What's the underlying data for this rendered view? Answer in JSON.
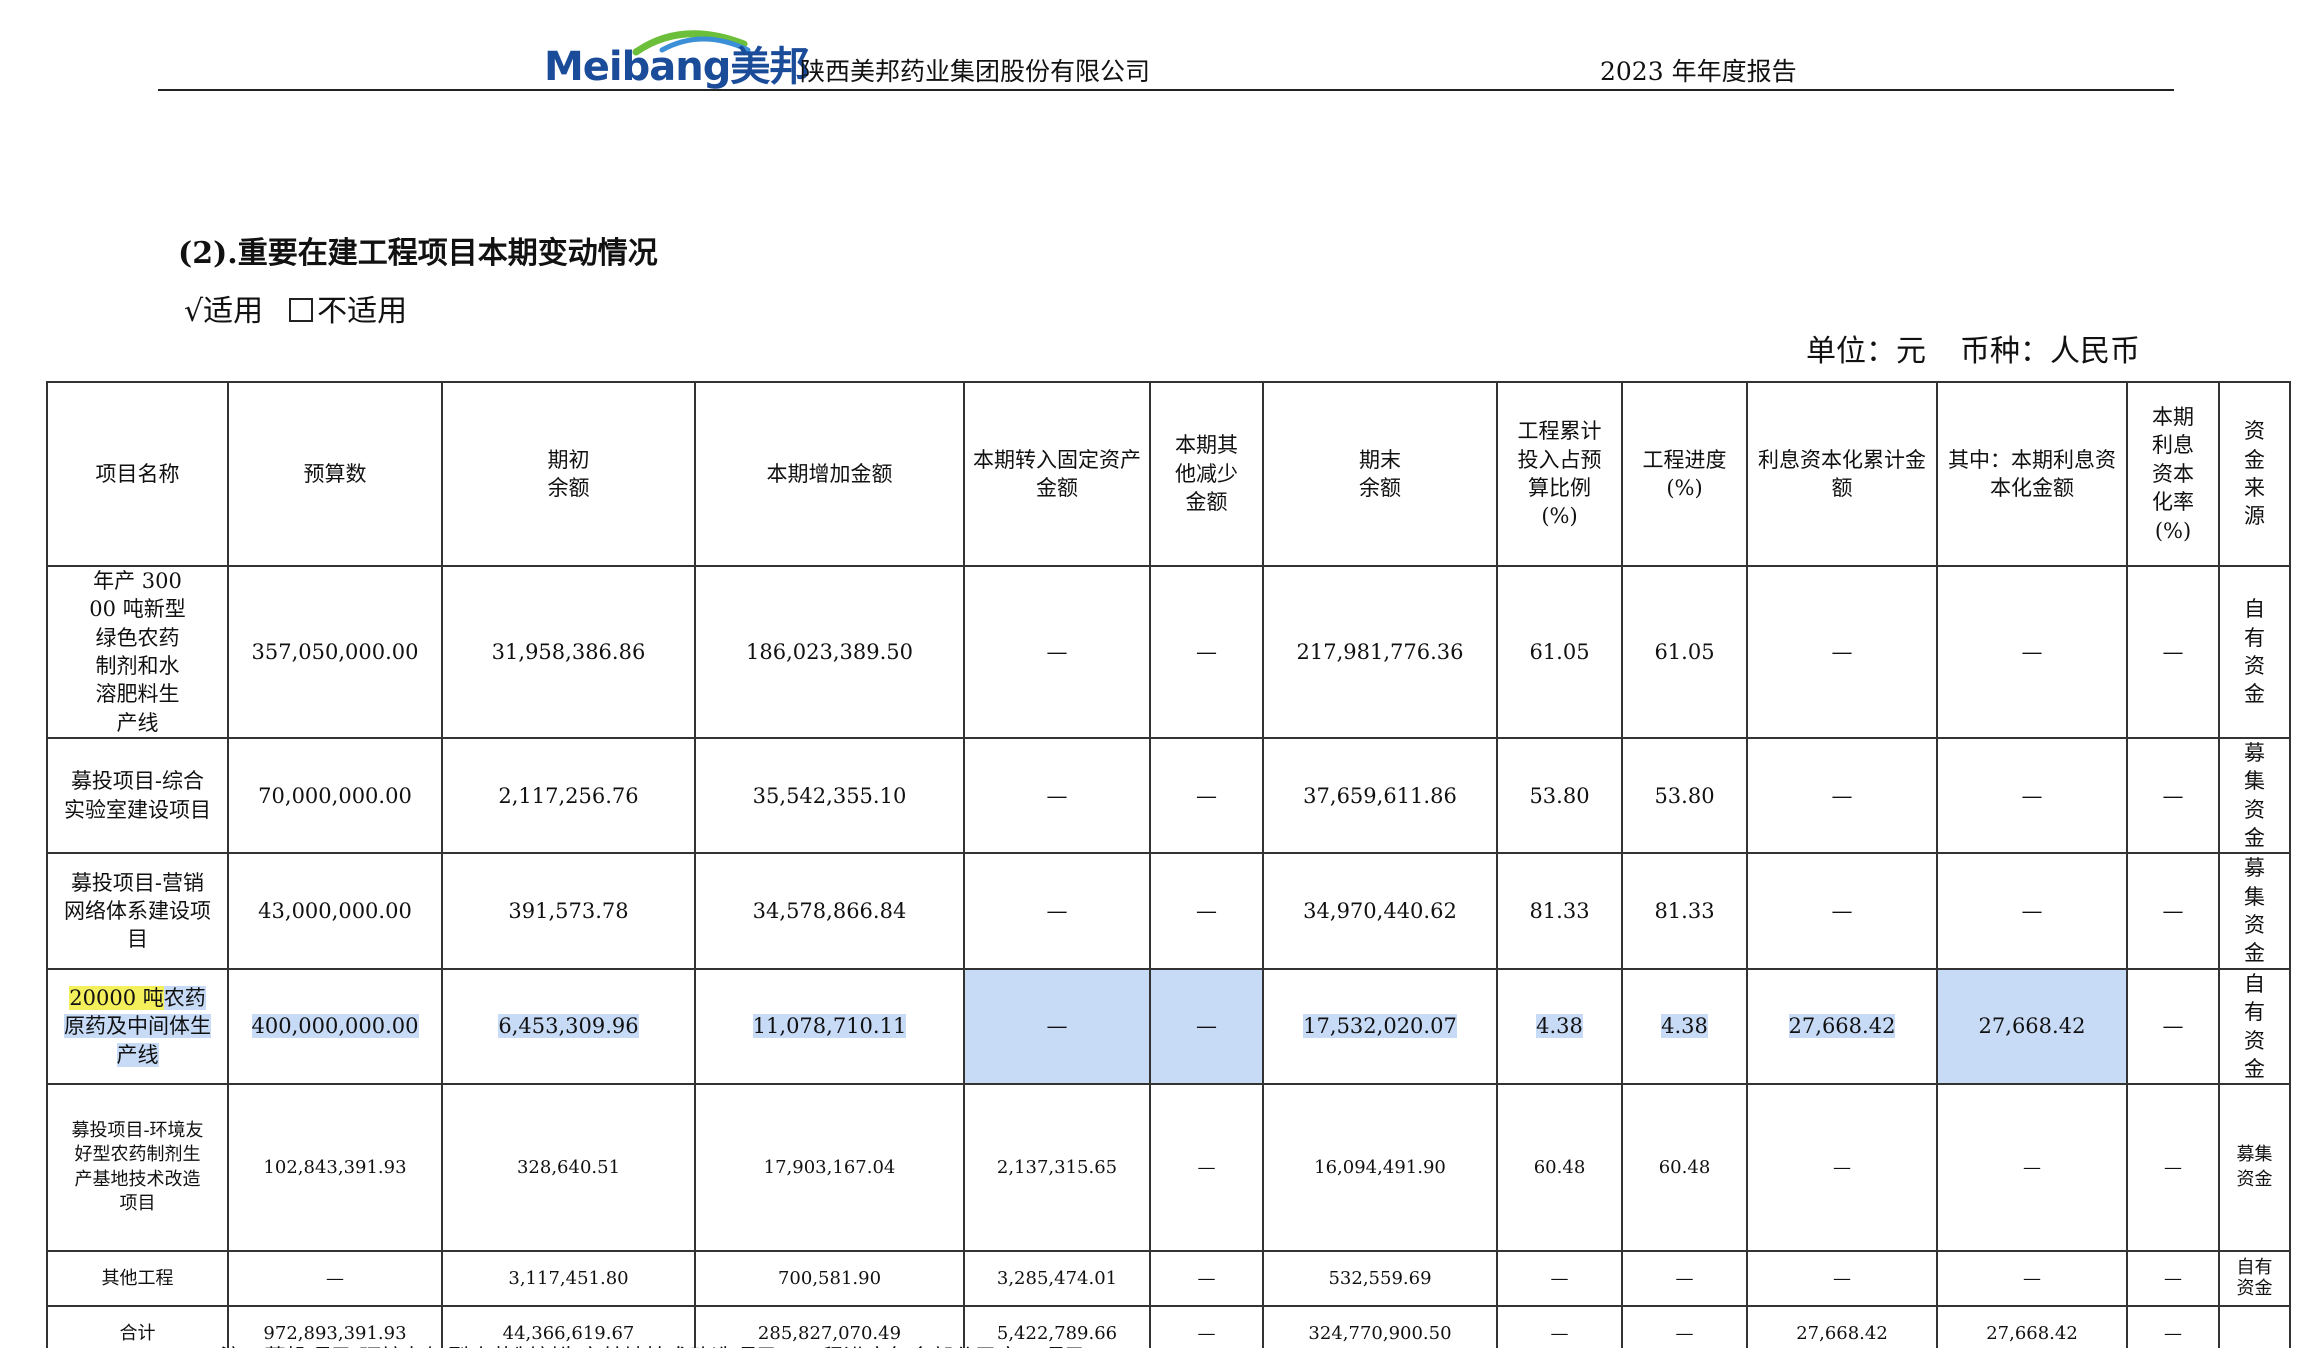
{
  "header": {
    "logo_text": "Meibang美邦",
    "company": "陕西美邦药业集团股份有限公司",
    "report": "2023 年年度报告"
  },
  "section": {
    "title": "(2).重要在建工程项目本期变动情况",
    "applicable": "√适用",
    "not_applicable": "不适用",
    "unit": "单位：元",
    "currency": "币种：人民币"
  },
  "table": {
    "headers": [
      "项目名称",
      "预算数",
      "期初\n余额",
      "本期增加金额",
      "本期转入固定资产金额",
      "本期其他减少金额",
      "期末\n余额",
      "工程累计投入占预算比例(%)",
      "工程进度(%)",
      "利息资本化累计金额",
      "其中：本期利息资本化金额",
      "本期利息资本化率(%)",
      "资金来源"
    ],
    "rows": [
      [
        "年产 30000 吨新型绿色农药制剂和水溶肥料生产线",
        "357,050,000.00",
        "31,958,386.86",
        "186,023,389.50",
        "—",
        "—",
        "217,981,776.36",
        "61.05",
        "61.05",
        "—",
        "—",
        "—",
        "自有资金"
      ],
      [
        "募投项目-综合实验室建设项目",
        "70,000,000.00",
        "2,117,256.76",
        "35,542,355.10",
        "—",
        "—",
        "37,659,611.86",
        "53.80",
        "53.80",
        "—",
        "—",
        "—",
        "募集资金"
      ],
      [
        "募投项目-营销网络体系建设项目",
        "43,000,000.00",
        "391,573.78",
        "34,578,866.84",
        "—",
        "—",
        "34,970,440.62",
        "81.33",
        "81.33",
        "—",
        "—",
        "—",
        "募集资金"
      ],
      [
        "20000 吨农药原药及中间体生产线",
        "400,000,000.00",
        "6,453,309.96",
        "11,078,710.11",
        "—",
        "—",
        "17,532,020.07",
        "4.38",
        "4.38",
        "27,668.42",
        "27,668.42",
        "—",
        "自有资金"
      ],
      [
        "募投项目-环境友好型农药制剂生产基地技术改造项目",
        "102,843,391.93",
        "328,640.51",
        "17,903,167.04",
        "2,137,315.65",
        "—",
        "16,094,491.90",
        "60.48",
        "60.48",
        "—",
        "—",
        "—",
        "募集资金"
      ],
      [
        "其他工程",
        "—",
        "3,117,451.80",
        "700,581.90",
        "3,285,474.01",
        "—",
        "532,559.69",
        "—",
        "—",
        "—",
        "—",
        "—",
        "自有资金"
      ],
      [
        "合计",
        "972,893,391.93",
        "44,366,619.67",
        "285,827,070.49",
        "5,422,789.66",
        "—",
        "324,770,900.50",
        "—",
        "—",
        "27,668.42",
        "27,668.42",
        "—",
        ""
      ]
    ],
    "row3_name_part1": "20000 吨",
    "row3_name_part2": "农药原药及中间体生产线"
  },
  "footnote": "注：募投项目-环境友好型农药制剂生产基地技术改造项目，工程进度包含部分已完工项目。",
  "colors": {
    "logo_blue": "#1b4c9a",
    "logo_green": "#6bbf3a",
    "selection": "#c7dbf7",
    "highlight": "#f3f05c"
  }
}
